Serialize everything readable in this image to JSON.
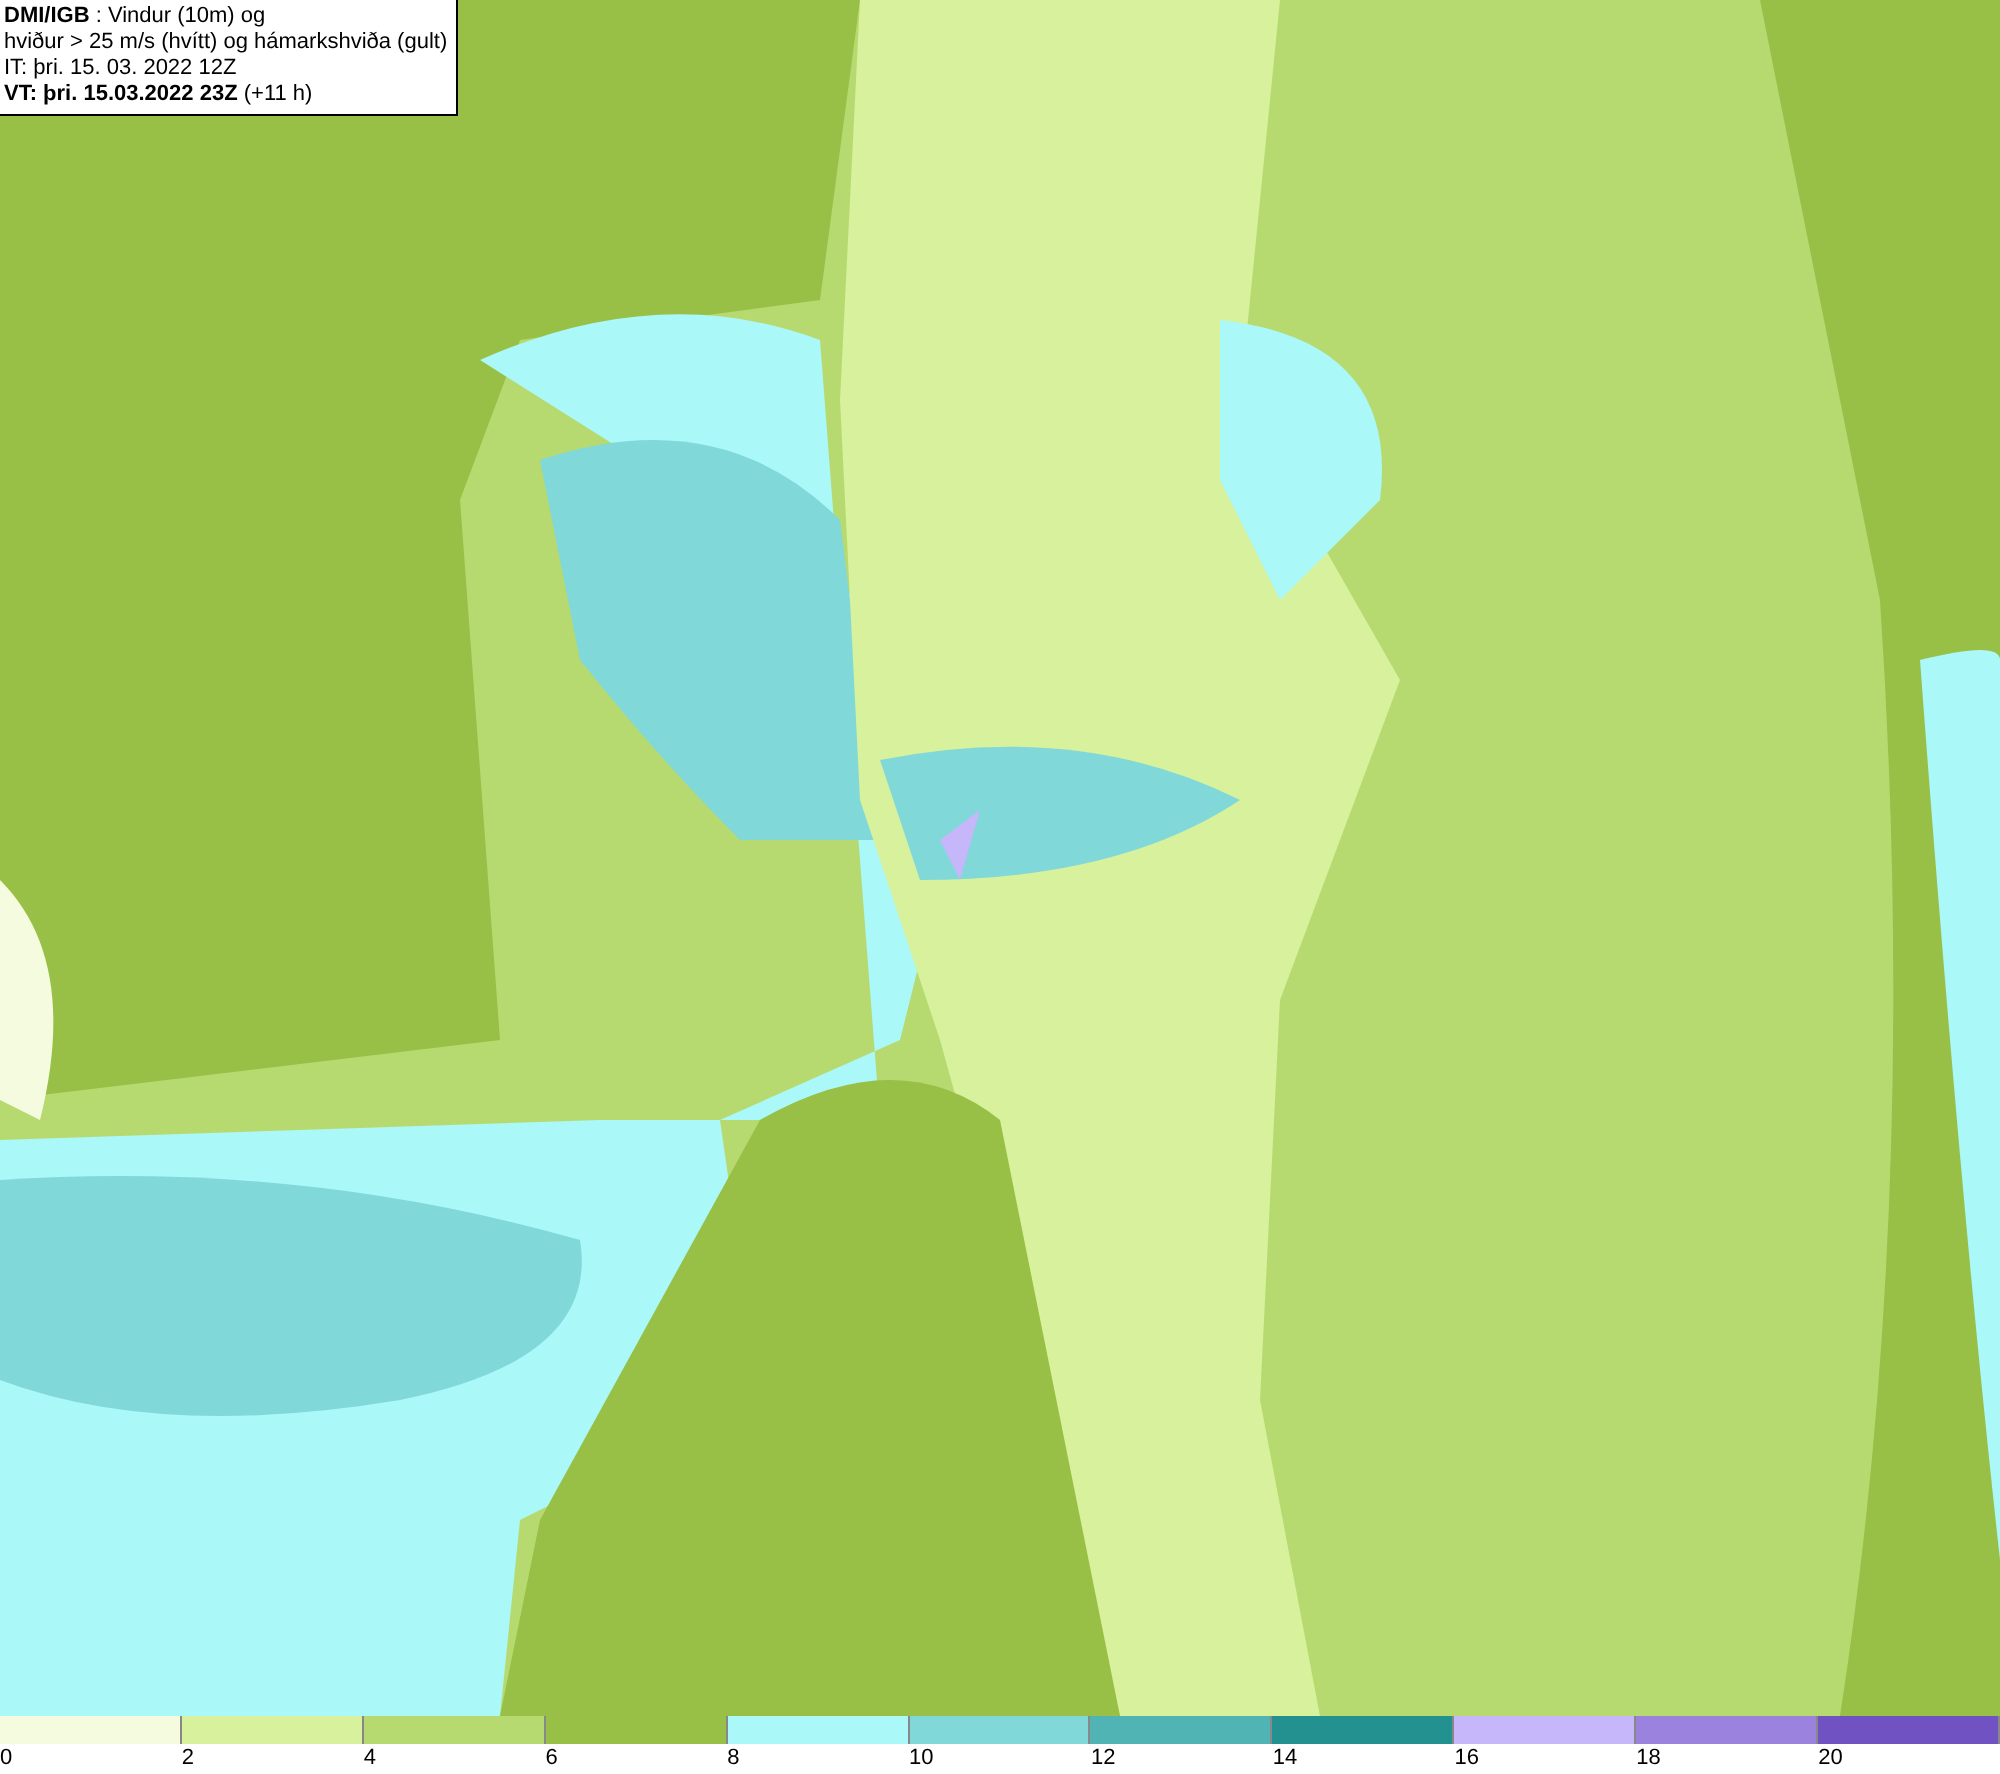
{
  "title_box": {
    "lines": [
      "**DMI/IGB** : Vindur (10m) og",
      "hviður > 25 m/s (hvítt) og hámarkshviða (gult)",
      "IT: þri. 15. 03. 2022 12Z",
      "**VT: þri. 15.03.2022 23Z** (+11 h)"
    ]
  },
  "legend": {
    "bins": [
      {
        "label": "0",
        "color": "#f4fbdf"
      },
      {
        "label": "2",
        "color": "#d7f19c"
      },
      {
        "label": "4",
        "color": "#b6da70"
      },
      {
        "label": "6",
        "color": "#98bf46"
      },
      {
        "label": "8",
        "color": "#aaf8f8"
      },
      {
        "label": "10",
        "color": "#80d8d8"
      },
      {
        "label": "12",
        "color": "#50b4b4"
      },
      {
        "label": "14",
        "color": "#22918f"
      },
      {
        "label": "16",
        "color": "#c6b6fa"
      },
      {
        "label": "18",
        "color": "#9a82de"
      },
      {
        "label": "20",
        "color": "#7052c2"
      }
    ]
  }
}
